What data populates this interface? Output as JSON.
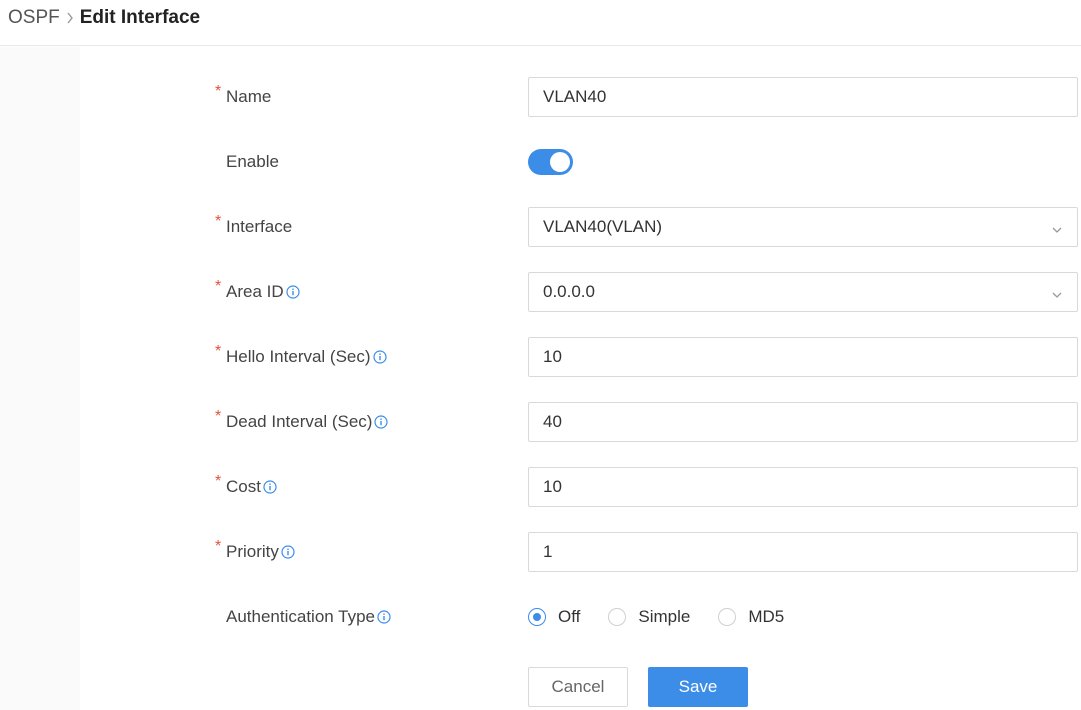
{
  "breadcrumb": {
    "parent": "OSPF",
    "separator": "›",
    "current": "Edit Interface"
  },
  "form": {
    "name": {
      "label": "Name",
      "required": true,
      "value": "VLAN40"
    },
    "enable": {
      "label": "Enable",
      "required": false,
      "value": true
    },
    "interface": {
      "label": "Interface",
      "required": true,
      "value": "VLAN40(VLAN)"
    },
    "area_id": {
      "label": "Area ID",
      "required": true,
      "value": "0.0.0.0"
    },
    "hello_interval": {
      "label": "Hello Interval (Sec)",
      "required": true,
      "value": "10"
    },
    "dead_interval": {
      "label": "Dead Interval (Sec)",
      "required": true,
      "value": "40"
    },
    "cost": {
      "label": "Cost",
      "required": true,
      "value": "10"
    },
    "priority": {
      "label": "Priority",
      "required": true,
      "value": "1"
    },
    "auth_type": {
      "label": "Authentication Type",
      "options": [
        "Off",
        "Simple",
        "MD5"
      ],
      "selected": "Off"
    }
  },
  "required_mark": "*",
  "buttons": {
    "cancel": "Cancel",
    "save": "Save"
  },
  "colors": {
    "accent": "#3b8de8",
    "required": "#e0533f",
    "border": "#d9d9d9"
  }
}
